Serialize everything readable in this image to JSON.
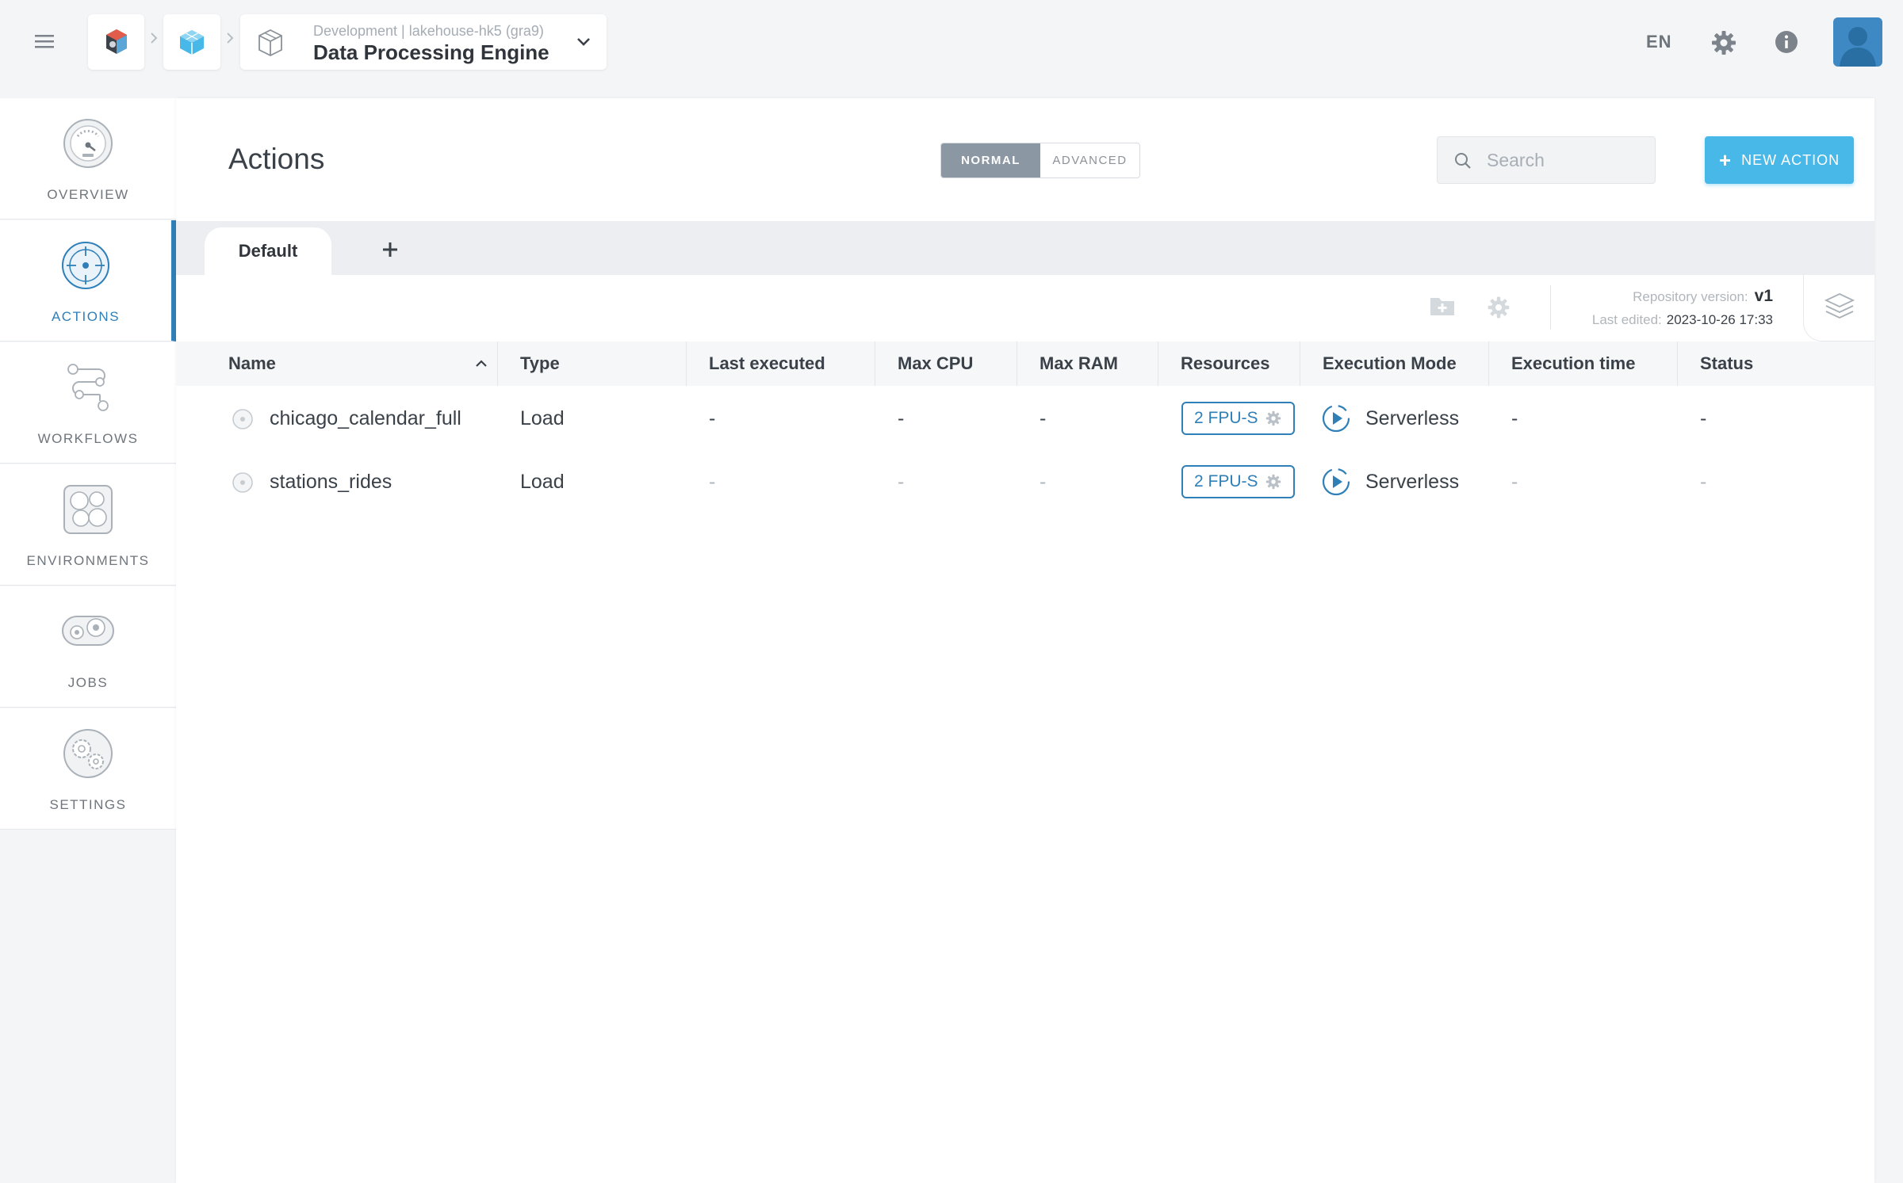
{
  "header": {
    "app_context": "Development  |  lakehouse-hk5 (gra9)",
    "app_title": "Data Processing Engine",
    "language": "EN"
  },
  "sidebar": {
    "items": [
      {
        "label": "OVERVIEW",
        "icon": "gauge-icon",
        "active": false
      },
      {
        "label": "ACTIONS",
        "icon": "target-icon",
        "active": true
      },
      {
        "label": "WORKFLOWS",
        "icon": "workflow-icon",
        "active": false
      },
      {
        "label": "ENVIRONMENTS",
        "icon": "environments-icon",
        "active": false
      },
      {
        "label": "JOBS",
        "icon": "jobs-icon",
        "active": false
      },
      {
        "label": "SETTINGS",
        "icon": "settings-gears-icon",
        "active": false
      }
    ]
  },
  "main": {
    "title": "Actions",
    "mode": {
      "normal": "NORMAL",
      "advanced": "ADVANCED",
      "selected": "NORMAL"
    },
    "search": {
      "placeholder": "Search",
      "value": ""
    },
    "new_action_label": "NEW ACTION",
    "tabs": [
      {
        "label": "Default",
        "active": true
      }
    ],
    "repository": {
      "version_label": "Repository version:",
      "version": "v1",
      "edited_label": "Last edited:",
      "edited": "2023-10-26 17:33"
    },
    "table": {
      "columns": [
        "Name",
        "Type",
        "Last executed",
        "Max CPU",
        "Max RAM",
        "Resources",
        "Execution Mode",
        "Execution time",
        "Status"
      ],
      "rows": [
        {
          "name": "chicago_calendar_full",
          "type": "Load",
          "last_executed": "-",
          "max_cpu": "-",
          "max_ram": "-",
          "resources": "2 FPU-S",
          "execution_mode": "Serverless",
          "execution_time": "-",
          "status": "-"
        },
        {
          "name": "stations_rides",
          "type": "Load",
          "last_executed": "-",
          "max_cpu": "-",
          "max_ram": "-",
          "resources": "2 FPU-S",
          "execution_mode": "Serverless",
          "execution_time": "-",
          "status": "-"
        }
      ]
    }
  },
  "colors": {
    "accent": "#2f7fb8",
    "button": "#47b8e8",
    "toggle_selected": "#8b97a2"
  }
}
